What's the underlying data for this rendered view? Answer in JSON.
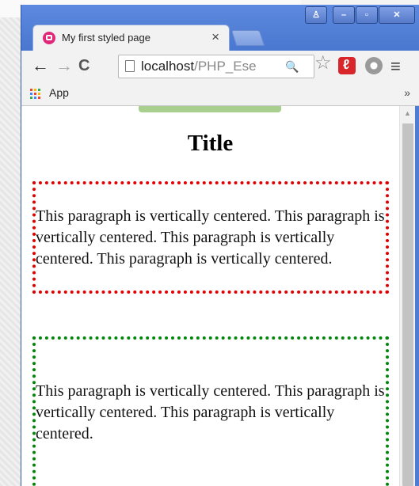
{
  "window": {
    "controls": {
      "user": "♙",
      "minimize": "–",
      "maximize": "▫",
      "close": "✕"
    }
  },
  "tab": {
    "title": "My first styled page",
    "close": "×",
    "favicon": "app-favicon-icon"
  },
  "toolbar": {
    "back": "←",
    "forward": "→",
    "reload": "C",
    "url_host": "localhost",
    "url_path": "/PHP_Ese",
    "zoom": "🔍",
    "star": "☆",
    "menu": "≡"
  },
  "bookmarks": {
    "apps_label": "App",
    "chevron": "»",
    "apps_icon_colors": [
      "#ea4335",
      "#fbbc05",
      "#34a853",
      "#4285f4",
      "#ea4335",
      "#fbbc05",
      "#34a853",
      "#4285f4",
      "#ea4335"
    ]
  },
  "page": {
    "title": "Title",
    "red_paragraph": "This paragraph is vertically centered. This paragraph is vertically centered. This paragraph is vertically centered. This paragraph is vertically centered.",
    "green_paragraph": "This paragraph is vertically centered. This paragraph is vertically centered. This paragraph is vertically centered.",
    "red_border_color": "#e10000",
    "green_border_color": "#00870a"
  },
  "scrollbar": {
    "up_arrow": "▲"
  }
}
